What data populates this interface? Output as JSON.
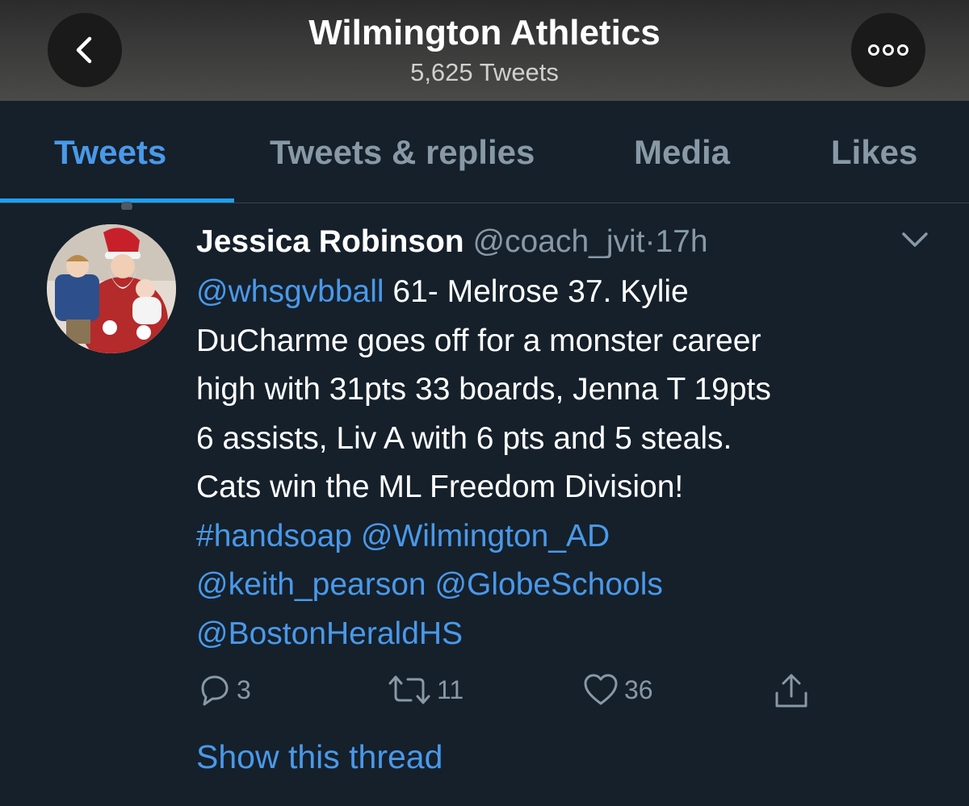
{
  "header": {
    "title": "Wilmington Athletics",
    "tweet_count": "5,625 Tweets",
    "back_icon": "chevron-left-icon",
    "more_icon": "more-icon"
  },
  "tabs": [
    {
      "label": "Tweets",
      "active": true
    },
    {
      "label": "Tweets & replies",
      "active": false
    },
    {
      "label": "Media",
      "active": false
    },
    {
      "label": "Likes",
      "active": false
    }
  ],
  "tweet": {
    "author": "Jessica Robinson",
    "handle": "@coach_jvit",
    "separator": "·",
    "time": "17h",
    "line1_mention": "@whsgvbball",
    "line1_text": " 61- Melrose 37. Kylie",
    "line2": "DuCharme goes off for a monster career",
    "line3": "high with 31pts 33 boards, Jenna T 19pts",
    "line4": "6 assists, Liv A with 6 pts and 5 steals.",
    "line5": "Cats win the ML Freedom Division!",
    "tag_hashtag": "#handsoap",
    "tag_1": "@Wilmington_AD",
    "tag_2": "@keith_pearson",
    "tag_3": "@GlobeSchools",
    "tag_4": "@BostonHeraldHS",
    "replies": "3",
    "retweets": "11",
    "likes": "36",
    "show_thread": "Show this thread"
  },
  "colors": {
    "background": "#15202b",
    "accent": "#1da1f2",
    "link": "#4a99e9",
    "muted": "#8899a6"
  }
}
